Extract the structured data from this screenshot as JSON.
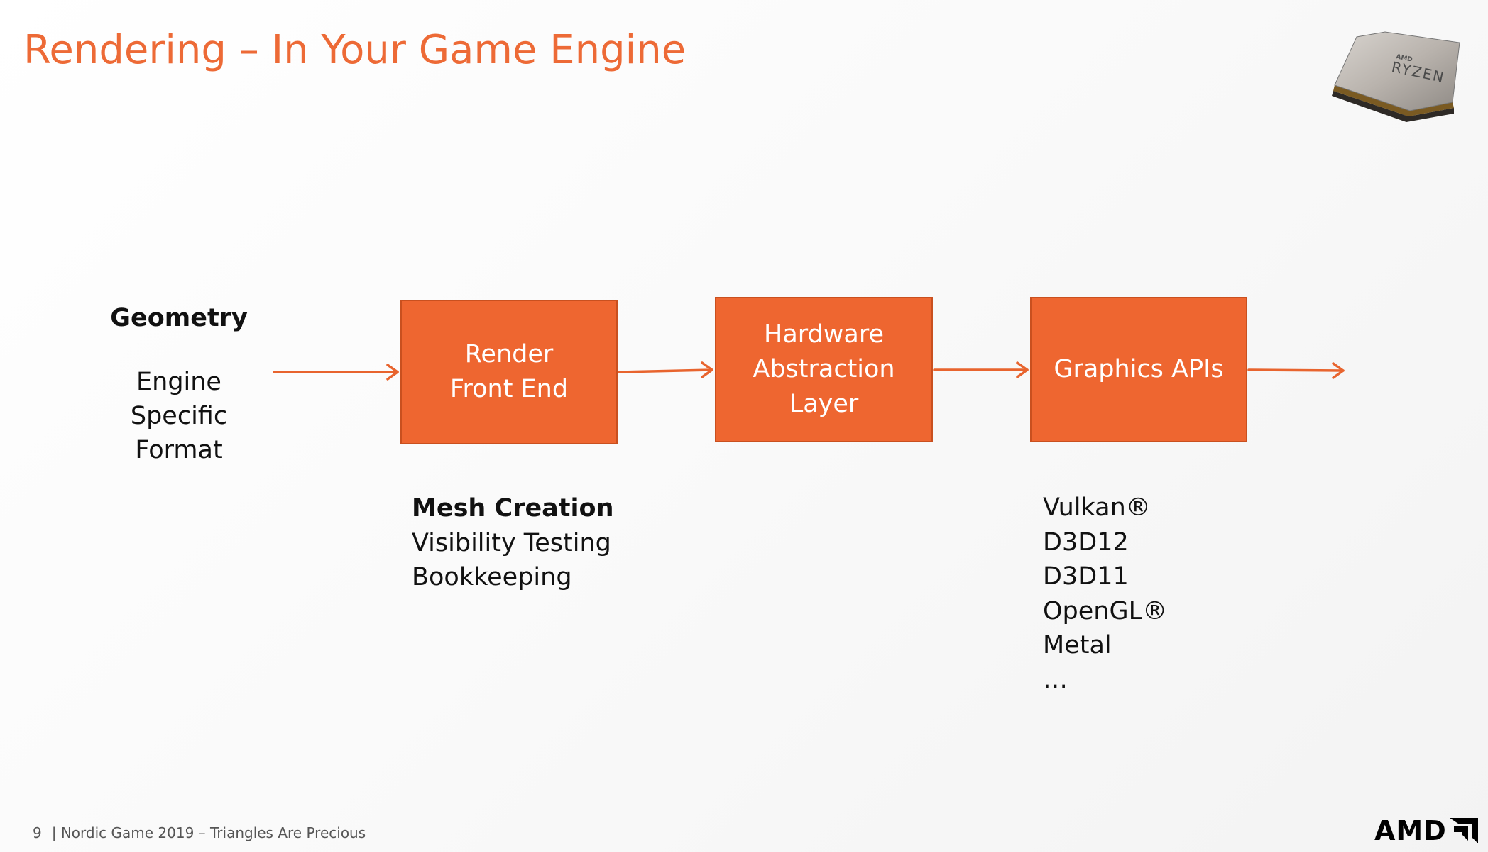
{
  "slide": {
    "title": "Rendering – In Your Game Engine"
  },
  "geometry": {
    "heading": "Geometry",
    "lines": [
      "Engine",
      "Specific",
      "Format"
    ]
  },
  "boxes": {
    "render_front_end": [
      "Render",
      "Front End"
    ],
    "hardware_abstraction_layer": [
      "Hardware",
      "Abstraction",
      "Layer"
    ],
    "graphics_apis": [
      "Graphics APIs"
    ]
  },
  "front_end_list": {
    "heading": "Mesh Creation",
    "items": [
      "Visibility Testing",
      "Bookkeeping"
    ]
  },
  "api_list": {
    "items": [
      "Vulkan®",
      "D3D12",
      "D3D11",
      "OpenGL®",
      "Metal",
      "…"
    ]
  },
  "chip": {
    "brand": "AMD",
    "name": "RYZEN"
  },
  "footer": {
    "page_number": "9",
    "text": "| Nordic Game 2019 – Triangles Are Precious"
  },
  "logo": {
    "text": "AMD"
  },
  "colors": {
    "accent": "#ED6A36",
    "box_fill": "#EE6630",
    "arrow": "#E8642E"
  }
}
